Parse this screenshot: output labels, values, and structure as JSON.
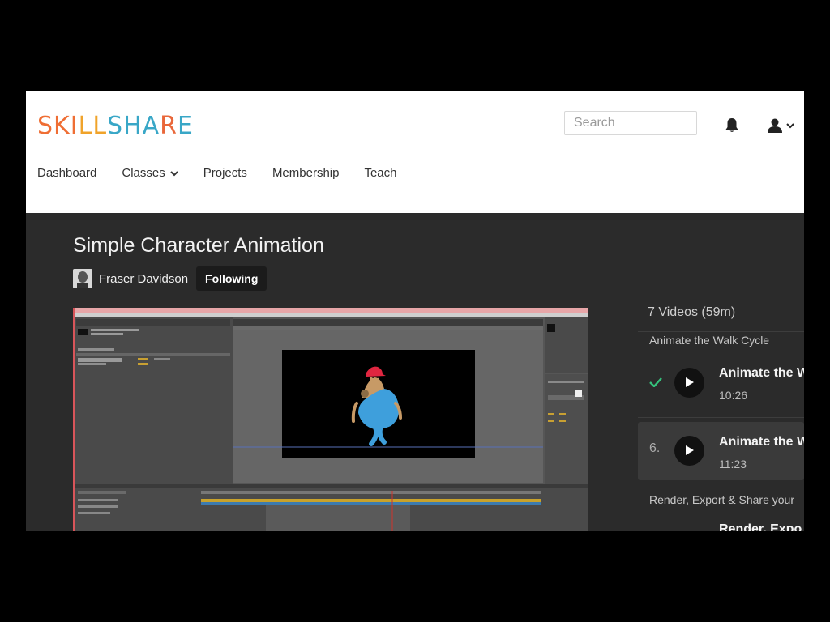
{
  "brand": {
    "letters": [
      {
        "ch": "S",
        "color": "#ef6e34"
      },
      {
        "ch": "K",
        "color": "#ef6e34"
      },
      {
        "ch": "I",
        "color": "#ef6e34"
      },
      {
        "ch": "L",
        "color": "#f0a32a"
      },
      {
        "ch": "L",
        "color": "#f0a32a"
      },
      {
        "ch": "S",
        "color": "#39a7c7"
      },
      {
        "ch": "H",
        "color": "#39a7c7"
      },
      {
        "ch": "A",
        "color": "#39a7c7"
      },
      {
        "ch": "R",
        "color": "#e9673a"
      },
      {
        "ch": "E",
        "color": "#39a7c7"
      }
    ]
  },
  "search": {
    "placeholder": "Search"
  },
  "nav": {
    "dashboard": "Dashboard",
    "classes": "Classes",
    "projects": "Projects",
    "membership": "Membership",
    "teach": "Teach"
  },
  "course": {
    "title": "Simple Character Animation",
    "author": "Fraser Davidson",
    "follow_label": "Following"
  },
  "playlist": {
    "count": "7 Videos (59m)",
    "section1": "Animate the Walk Cycle",
    "lessons": [
      {
        "title": "Animate the W",
        "duration": "10:26",
        "completed": true
      },
      {
        "number": "6.",
        "title": "Animate the W",
        "duration": "11:23",
        "active": true
      }
    ],
    "section2": "Render, Export & Share your",
    "next_title": "Render, Expo"
  },
  "colors": {
    "accent_check": "#35c27c",
    "dark_bg": "#2b2b2b"
  }
}
